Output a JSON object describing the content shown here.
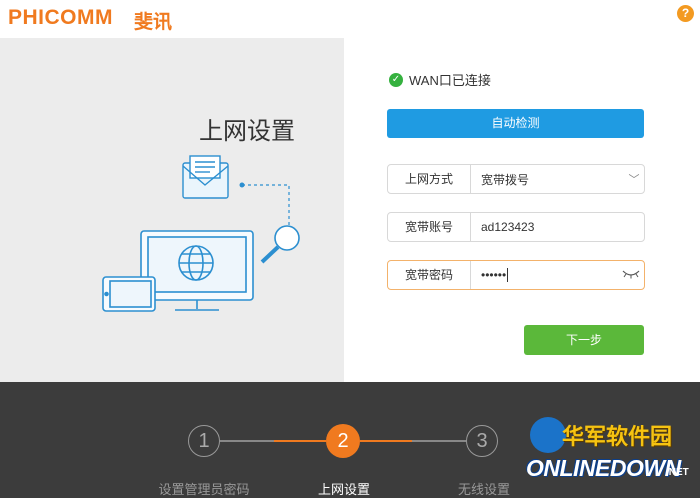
{
  "header": {
    "logo": "PHICOMM",
    "logo_cn": "斐讯",
    "help": "?"
  },
  "page": {
    "title": "上网设置"
  },
  "status": {
    "text": "WAN口已连接"
  },
  "buttons": {
    "detect": "自动检测",
    "next": "下一步"
  },
  "fields": {
    "mode": {
      "label": "上网方式",
      "value": "宽带拨号"
    },
    "account": {
      "label": "宽带账号",
      "value": "ad123423"
    },
    "password": {
      "label": "宽带密码",
      "value": "••••••"
    }
  },
  "steps": [
    {
      "number": "1",
      "label": "设置管理员密码"
    },
    {
      "number": "2",
      "label": "上网设置"
    },
    {
      "number": "3",
      "label": "无线设置"
    }
  ],
  "watermark": {
    "line1": "华军软件园",
    "line2": "ONLINEDOWN",
    "suffix": ".NET"
  },
  "colors": {
    "brand": "#f07a1f",
    "primary": "#1f9be2",
    "success": "#5bb83a",
    "active_step": "#f07a1f"
  }
}
